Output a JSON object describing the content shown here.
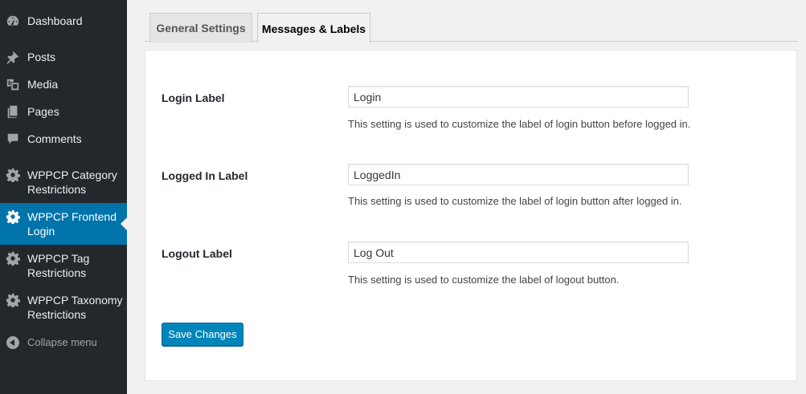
{
  "sidebar": {
    "items": [
      {
        "label": "Dashboard",
        "icon": "dashboard-icon"
      },
      {
        "label": "Posts",
        "icon": "pin-icon"
      },
      {
        "label": "Media",
        "icon": "media-icon"
      },
      {
        "label": "Pages",
        "icon": "pages-icon"
      },
      {
        "label": "Comments",
        "icon": "comment-icon"
      },
      {
        "label": "WPPCP Category Restrictions",
        "icon": "gear-icon"
      },
      {
        "label": "WPPCP Frontend Login",
        "icon": "gear-icon",
        "current": true
      },
      {
        "label": "WPPCP Tag Restrictions",
        "icon": "gear-icon"
      },
      {
        "label": "WPPCP Taxonomy Restrictions",
        "icon": "gear-icon"
      }
    ],
    "collapse_label": "Collapse menu"
  },
  "tabs": [
    {
      "label": "General Settings",
      "active": false
    },
    {
      "label": "Messages & Labels",
      "active": true
    }
  ],
  "form": {
    "rows": [
      {
        "label": "Login Label",
        "value": "Login",
        "description": "This setting is used to customize the label of login button before logged in."
      },
      {
        "label": "Logged In Label",
        "value": "LoggedIn",
        "description": "This setting is used to customize the label of login button after logged in."
      },
      {
        "label": "Logout Label",
        "value": "Log Out",
        "description": "This setting is used to customize the label of logout button."
      }
    ],
    "save_label": "Save Changes"
  },
  "colors": {
    "sidebar_bg": "#23282d",
    "accent": "#0073aa",
    "button": "#0085ba",
    "page_bg": "#f1f1f1"
  }
}
